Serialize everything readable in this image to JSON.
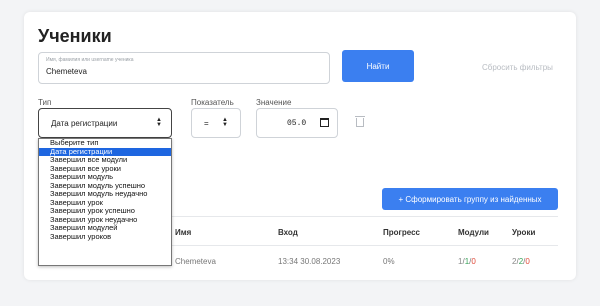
{
  "page": {
    "title": "Ученики"
  },
  "search": {
    "placeholder": "Имя, фамилия или username ученика",
    "value": "Chemeteva",
    "find_label": "Найти",
    "reset_label": "Сбросить фильтры"
  },
  "filters": {
    "type_label": "Тип",
    "type_selected": "Дата регистрации",
    "indicator_label": "Показатель",
    "indicator_selected": "=",
    "value_label": "Значение",
    "value": "05.0"
  },
  "dropdown": {
    "items": [
      "Выберите тип",
      "Дата регистрации",
      "Завершил все модули",
      "Завершил все уроки",
      "Завершил модуль",
      "Завершил модуль успешно",
      "Завершил модуль неудачно",
      "Завершил урок",
      "Завершил урок успешно",
      "Завершил урок неудачно",
      "Завершил модулей",
      "Завершил уроков"
    ],
    "selected_index": 1
  },
  "group_button": "+ Сформировать группу из найденных",
  "table": {
    "headers": {
      "name": "Имя",
      "login": "Вход",
      "progress": "Прогресс",
      "modules": "Модули",
      "lessons": "Уроки"
    },
    "rows": [
      {
        "name": "Chemeteva",
        "login": "13:34 30.08.2023",
        "progress": "0%",
        "modules": {
          "a": "1",
          "b": "1",
          "c": "0"
        },
        "lessons": {
          "a": "2",
          "b": "2",
          "c": "0"
        }
      }
    ]
  },
  "colors": {
    "accent": "#3b7ff0",
    "selected": "#1e66e0",
    "ok": "#3aa55c",
    "fail": "#e04a3a"
  }
}
